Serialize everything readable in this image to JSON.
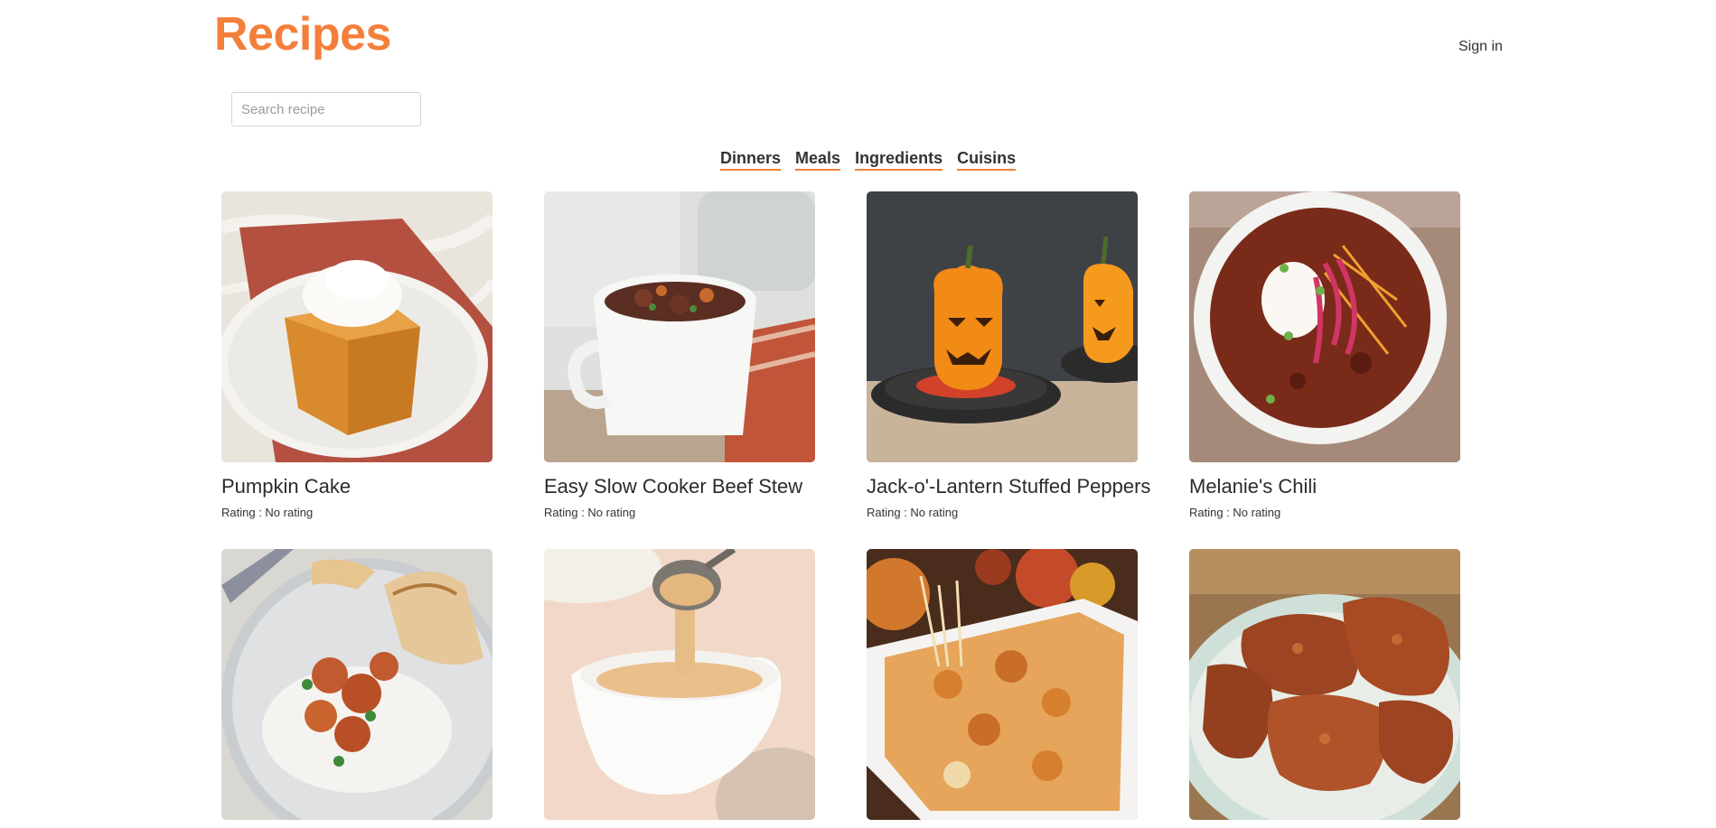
{
  "header": {
    "brand": "Recipes",
    "sign_in_label": "Sign in"
  },
  "search": {
    "placeholder": "Search recipe",
    "value": ""
  },
  "nav": {
    "items": [
      {
        "label": "Dinners"
      },
      {
        "label": "Meals"
      },
      {
        "label": "Ingredients"
      },
      {
        "label": "Cuisins"
      }
    ]
  },
  "colors": {
    "accent": "#f47f3b"
  },
  "recipes": [
    {
      "title": "Pumpkin Cake",
      "rating_label": "Rating : ",
      "rating_value": "No rating",
      "image": "pumpkin-cake-photo"
    },
    {
      "title": "Easy Slow Cooker Beef Stew",
      "rating_label": "Rating : ",
      "rating_value": "No rating",
      "image": "beef-stew-photo"
    },
    {
      "title": "Jack-o'-Lantern Stuffed Peppers",
      "rating_label": "Rating : ",
      "rating_value": "No rating",
      "image": "stuffed-peppers-photo"
    },
    {
      "title": "Melanie's Chili",
      "rating_label": "Rating : ",
      "rating_value": "No rating",
      "image": "chili-photo"
    },
    {
      "image": "butter-chicken-photo"
    },
    {
      "image": "gravy-boat-photo"
    },
    {
      "image": "baked-pasta-photo"
    },
    {
      "image": "fried-chicken-photo"
    }
  ]
}
